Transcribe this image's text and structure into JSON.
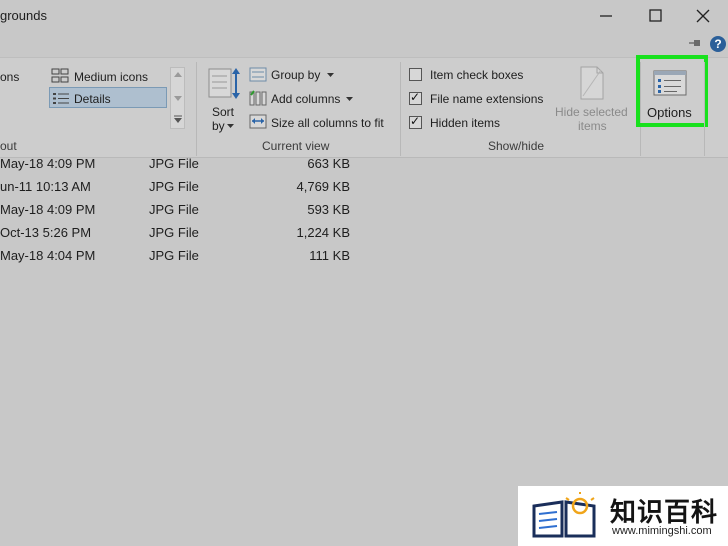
{
  "window": {
    "title": "grounds",
    "minimize_icon": "minimize-icon",
    "maximize_icon": "maximize-icon",
    "close_icon": "close-icon"
  },
  "ribbon_top": {
    "pin_icon": "pin-icon",
    "help_label": "?"
  },
  "layout": {
    "item_icons_partial": "ons",
    "medium_icons": "Medium icons",
    "details": "Details",
    "section": "out"
  },
  "current_view": {
    "sort_line1": "Sort",
    "sort_line2": "by",
    "group_by": "Group by",
    "add_columns": "Add columns",
    "size_all": "Size all columns to fit",
    "section": "Current view"
  },
  "show_hide": {
    "item_check_boxes": {
      "label": "Item check boxes",
      "checked": false
    },
    "file_name_extensions": {
      "label": "File name extensions",
      "checked": true
    },
    "hidden_items": {
      "label": "Hidden items",
      "checked": true
    },
    "hide_selected_line1": "Hide selected",
    "hide_selected_line2": "items",
    "section": "Show/hide"
  },
  "options": {
    "label": "Options",
    "highlight_color": "#18e11d"
  },
  "files": [
    {
      "date": "May-18 4:09 PM",
      "type": "JPG File",
      "size": "663 KB"
    },
    {
      "date": "un-11 10:13 AM",
      "type": "JPG File",
      "size": "4,769 KB"
    },
    {
      "date": "May-18 4:09 PM",
      "type": "JPG File",
      "size": "593 KB"
    },
    {
      "date": "Oct-13 5:26 PM",
      "type": "JPG File",
      "size": "1,224 KB"
    },
    {
      "date": "May-18 4:04 PM",
      "type": "JPG File",
      "size": "111 KB"
    }
  ],
  "watermark": {
    "main": "知识百科",
    "sub": "www.mimingshi.com"
  }
}
